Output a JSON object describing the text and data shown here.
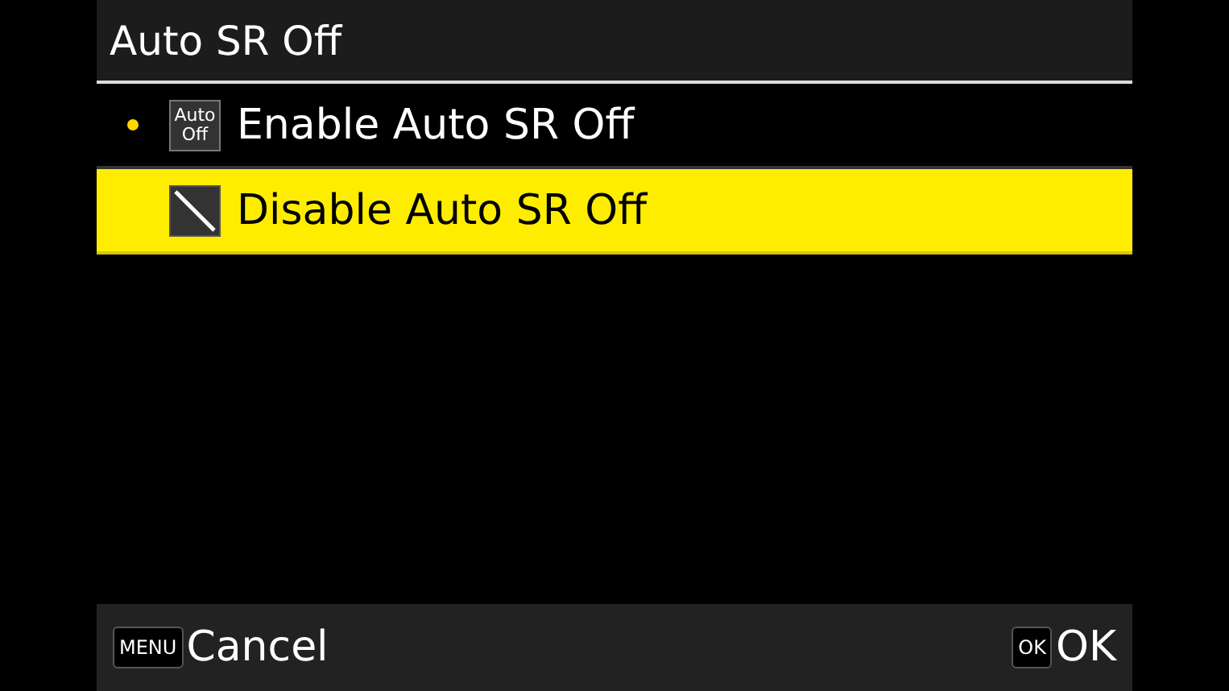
{
  "title": "Auto SR Off",
  "options": [
    {
      "label": "Enable Auto SR Off",
      "icon_lines": [
        "Auto",
        "Off"
      ],
      "struck": false,
      "current": true,
      "selected": false
    },
    {
      "label": "Disable Auto SR Off",
      "struck": true,
      "current": false,
      "selected": true
    }
  ],
  "footer": [
    {
      "key": "MENU",
      "label": "Cancel"
    },
    {
      "key": "OK",
      "label": "OK"
    }
  ]
}
